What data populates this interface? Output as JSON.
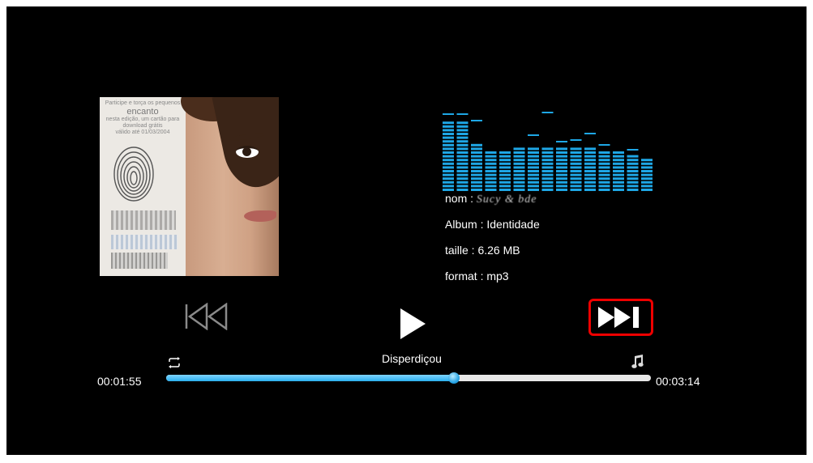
{
  "track": {
    "name_label": "nom : ",
    "name_value": "Sucy & bde",
    "album_label": "Album : Identidade",
    "size_label": "taille : 6.26 MB",
    "format_label": "format :  mp3",
    "title": "Disperdiçou"
  },
  "album_art": {
    "promo_line1": "Participe e torça os pequenos",
    "promo_big": "encanto",
    "promo_line2": "nesta edição, um cartão para",
    "promo_line3": "download grátis",
    "promo_line4": "válido até 01/03/2004"
  },
  "playback": {
    "elapsed": "00:01:55",
    "total": "00:03:14",
    "progress_fraction": 0.593
  },
  "equalizer": {
    "color": "#1ea7e6",
    "bars": [
      {
        "level": 0.88,
        "peak": 0.96
      },
      {
        "level": 0.88,
        "peak": 0.96
      },
      {
        "level": 0.6,
        "peak": 0.88
      },
      {
        "level": 0.5,
        "peak": 0.5
      },
      {
        "level": 0.52,
        "peak": 0.52
      },
      {
        "level": 0.55,
        "peak": 0.56
      },
      {
        "level": 0.55,
        "peak": 0.7
      },
      {
        "level": 0.55,
        "peak": 0.98
      },
      {
        "level": 0.55,
        "peak": 0.62
      },
      {
        "level": 0.55,
        "peak": 0.64
      },
      {
        "level": 0.55,
        "peak": 0.72
      },
      {
        "level": 0.52,
        "peak": 0.58
      },
      {
        "level": 0.5,
        "peak": 0.5
      },
      {
        "level": 0.48,
        "peak": 0.52
      },
      {
        "level": 0.44,
        "peak": 0.46
      }
    ]
  },
  "icons": {
    "prev": "skip-previous-icon",
    "play": "play-icon",
    "next": "skip-next-icon",
    "repeat": "repeat-icon",
    "music": "music-note-icon"
  },
  "colors": {
    "background": "#000000",
    "progress": "#2ab0ee",
    "highlight": "#ee0000"
  }
}
